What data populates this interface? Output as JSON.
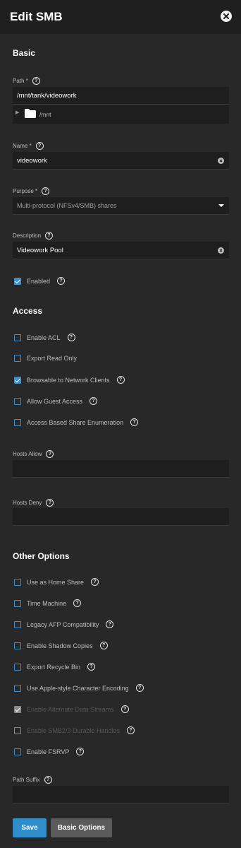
{
  "dialog": {
    "title": "Edit SMB"
  },
  "sections": {
    "basic": "Basic",
    "access": "Access",
    "other": "Other Options"
  },
  "fields": {
    "path": {
      "label": "Path *",
      "value": "/mnt/tank/videowork"
    },
    "tree": {
      "root": "/mnt"
    },
    "name": {
      "label": "Name *",
      "value": "videowork"
    },
    "purpose": {
      "label": "Purpose *",
      "value": "Multi-protocol (NFSv4/SMB) shares"
    },
    "description": {
      "label": "Description",
      "value": "Videowork Pool"
    },
    "hosts_allow": {
      "label": "Hosts Allow",
      "value": ""
    },
    "hosts_deny": {
      "label": "Hosts Deny",
      "value": ""
    },
    "path_suffix": {
      "label": "Path Suffix",
      "value": ""
    }
  },
  "enabled": {
    "label": "Enabled",
    "checked": true
  },
  "access_options": [
    {
      "label": "Enable ACL",
      "checked": false
    },
    {
      "label": "Export Read Only",
      "checked": false
    },
    {
      "label": "Browsable to Network Clients",
      "checked": true
    },
    {
      "label": "Allow Guest Access",
      "checked": false
    },
    {
      "label": "Access Based Share Enumeration",
      "checked": false
    }
  ],
  "other_options": [
    {
      "label": "Use as Home Share",
      "checked": false
    },
    {
      "label": "Time Machine",
      "checked": false
    },
    {
      "label": "Legacy AFP Compatibility",
      "checked": false
    },
    {
      "label": "Enable Shadow Copies",
      "checked": false
    },
    {
      "label": "Export Recycle Bin",
      "checked": false
    },
    {
      "label": "Use Apple-style Character Encoding",
      "checked": false
    },
    {
      "label": "Enable Alternate Data Streams",
      "checked": true,
      "disabled": true
    },
    {
      "label": "Enable SMB2/3 Durable Handles",
      "checked": false,
      "disabled": true
    },
    {
      "label": "Enable FSRVP",
      "checked": false
    }
  ],
  "buttons": {
    "save": "Save",
    "basic_options": "Basic Options"
  },
  "help_glyph": "?",
  "colors": {
    "accent": "#2f8dcc",
    "background": "#282828",
    "header": "#1f1f1f"
  }
}
